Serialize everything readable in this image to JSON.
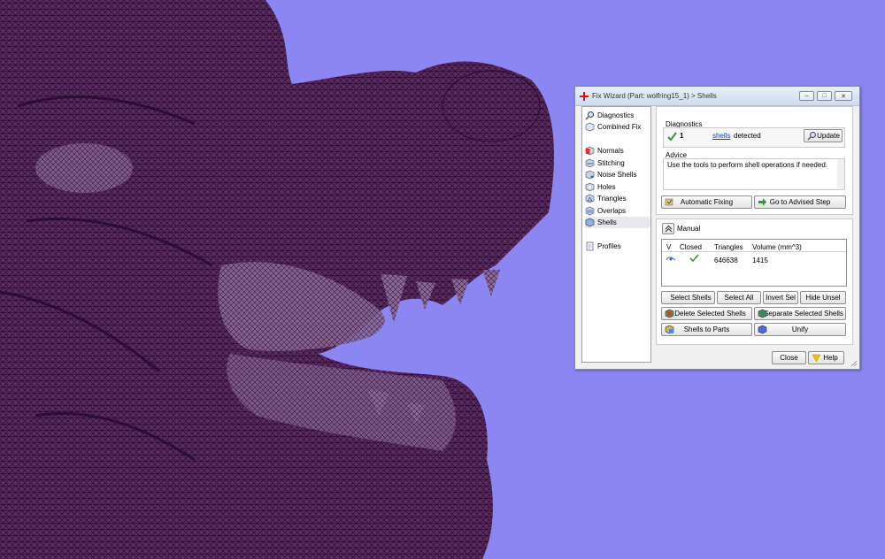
{
  "window": {
    "title": "Fix Wizard (Part: wolfring15_1) > Shells",
    "minimize": "–",
    "maximize": "□",
    "close": "✕"
  },
  "nav": {
    "items": [
      {
        "label": "Diagnostics",
        "icon": "magnifier-icon"
      },
      {
        "label": "Combined Fix",
        "icon": "cube-icon"
      },
      {
        "label": "Normals",
        "icon": "normals-icon"
      },
      {
        "label": "Stitching",
        "icon": "stitching-icon"
      },
      {
        "label": "Noise Shells",
        "icon": "noise-shells-icon"
      },
      {
        "label": "Holes",
        "icon": "holes-icon"
      },
      {
        "label": "Triangles",
        "icon": "triangles-icon"
      },
      {
        "label": "Overlaps",
        "icon": "overlaps-icon"
      },
      {
        "label": "Shells",
        "icon": "shells-icon"
      },
      {
        "label": "Profiles",
        "icon": "profiles-icon"
      }
    ]
  },
  "diagnostics": {
    "title": "Diagnostics",
    "count": "1",
    "link": "shells",
    "suffix": "detected",
    "update": "Update"
  },
  "advice": {
    "title": "Advice",
    "text": "Use the tools to perform shell operations if needed."
  },
  "actions": {
    "automatic": "Automatic Fixing",
    "advised": "Go to Advised Step"
  },
  "manual": {
    "title": "Manual",
    "columns": [
      "V",
      "Closed",
      "Triangles",
      "Volume (mm^3)"
    ],
    "rows": [
      {
        "triangles": "646638",
        "volume": "1415"
      }
    ],
    "buttons": {
      "select_shells": "Select Shells",
      "select_all": "Select All",
      "invert_sel": "Invert Sel",
      "hide_unsel": "Hide Unsel",
      "delete_selected": "Delete Selected Shells",
      "separate_selected": "Separate Selected Shells",
      "shells_to_parts": "Shells to Parts",
      "unify": "Unify"
    }
  },
  "footer": {
    "close": "Close",
    "help": "Help"
  },
  "colors": {
    "background": "#8b86f2",
    "mesh": "#3d1140",
    "accent_green": "#2f9a2f",
    "link": "#1a3dd6"
  }
}
